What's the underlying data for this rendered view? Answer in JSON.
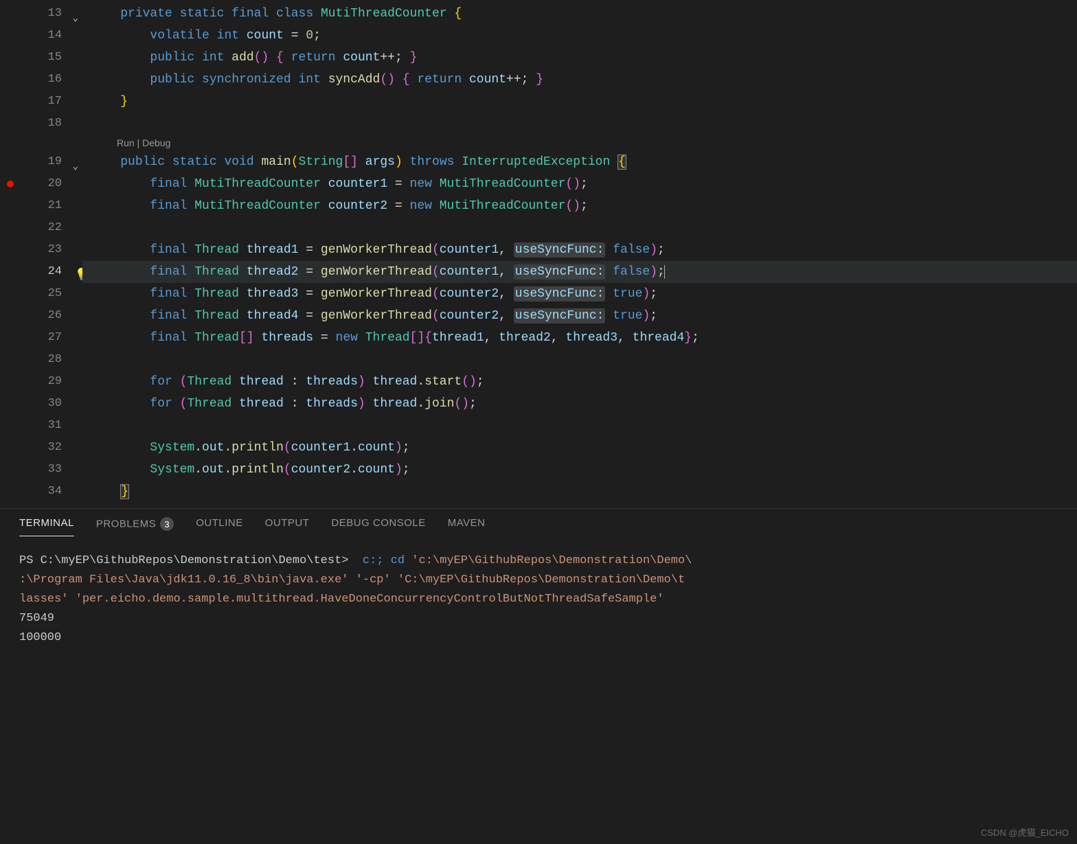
{
  "code": {
    "lines": [
      "13",
      "14",
      "15",
      "16",
      "17",
      "18",
      "19",
      "20",
      "21",
      "22",
      "23",
      "24",
      "25",
      "26",
      "27",
      "28",
      "29",
      "30",
      "31",
      "32",
      "33",
      "34"
    ],
    "codelens_run": "Run",
    "codelens_debug": "Debug",
    "active_line": "24",
    "breakpoint_line": "20",
    "bulb_line": "24"
  },
  "tokens": {
    "private": "private",
    "static": "static",
    "final": "final",
    "class": "class",
    "volatile": "volatile",
    "int": "int",
    "public": "public",
    "void": "void",
    "synchronized": "synchronized",
    "return": "return",
    "throws": "throws",
    "new": "new",
    "for": "for",
    "MutiThreadCounter": "MutiThreadCounter",
    "Thread": "Thread",
    "ThreadArr": "Thread",
    "String": "String",
    "InterruptedException": "InterruptedException",
    "System": "System",
    "count": "count",
    "add": "add",
    "syncAdd": "syncAdd",
    "main": "main",
    "args": "args",
    "counter1": "counter1",
    "counter2": "counter2",
    "thread1": "thread1",
    "thread2": "thread2",
    "thread3": "thread3",
    "thread4": "thread4",
    "threads": "threads",
    "thread": "thread",
    "genWorkerThread": "genWorkerThread",
    "useSyncFunc": "useSyncFunc:",
    "false": "false",
    "true": "true",
    "zero": "0",
    "out": "out",
    "println": "println",
    "start": "start",
    "join": "join"
  },
  "panel": {
    "tabs": {
      "terminal": "TERMINAL",
      "problems": "PROBLEMS",
      "problems_badge": "3",
      "outline": "OUTLINE",
      "output": "OUTPUT",
      "debug": "DEBUG CONSOLE",
      "maven": "MAVEN"
    }
  },
  "terminal": {
    "prompt": "PS C:\\myEP\\GithubRepos\\Demonstration\\Demo\\test> ",
    "cmd_part1": " c:; ",
    "cmd_cd": "cd",
    "cmd_path1": " 'c:\\myEP\\GithubRepos\\Demonstration\\Demo\\",
    "line2": ":\\Program Files\\Java\\jdk11.0.16_8\\bin\\java.exe' '-cp' 'C:\\myEP\\GithubRepos\\Demonstration\\Demo\\t",
    "line3a": "lasses'",
    "line3b": " 'per.eicho.demo.sample.multithread.HaveDoneConcurrencyControlButNotThreadSafeSample'",
    "out1": "75049",
    "out2": "100000"
  },
  "watermark": "CSDN @虎猫_EICHO"
}
